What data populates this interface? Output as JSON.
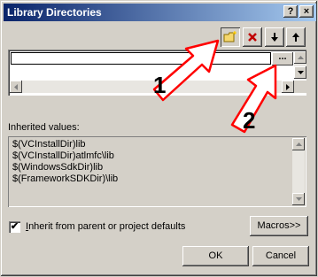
{
  "window": {
    "title": "Library Directories",
    "help_btn": "?",
    "close_btn": "×"
  },
  "toolbar": {
    "new_line_icon": "new-folder-icon",
    "delete_icon": "delete-x-icon",
    "move_down_icon": "arrow-down-icon",
    "move_up_icon": "arrow-up-icon"
  },
  "directories": {
    "edit_value": "",
    "browse_label": "..."
  },
  "inherited": {
    "label": "Inherited values:",
    "values": [
      "$(VCInstallDir)lib",
      "$(VCInstallDir)atlmfc\\lib",
      "$(WindowsSdkDir)lib",
      "$(FrameworkSDKDir)\\lib"
    ]
  },
  "inherit_checkbox": {
    "checked": true,
    "label": "Inherit from parent or project defaults"
  },
  "buttons": {
    "macros": "Macros>>",
    "ok": "OK",
    "cancel": "Cancel"
  },
  "annotations": {
    "callout_1": "1",
    "callout_2": "2"
  },
  "colors": {
    "title_start": "#0a246a",
    "title_end": "#a6caf0",
    "callout_fill": "#ffffff",
    "callout_border": "#ff0000",
    "delete_icon": "#c00000"
  }
}
